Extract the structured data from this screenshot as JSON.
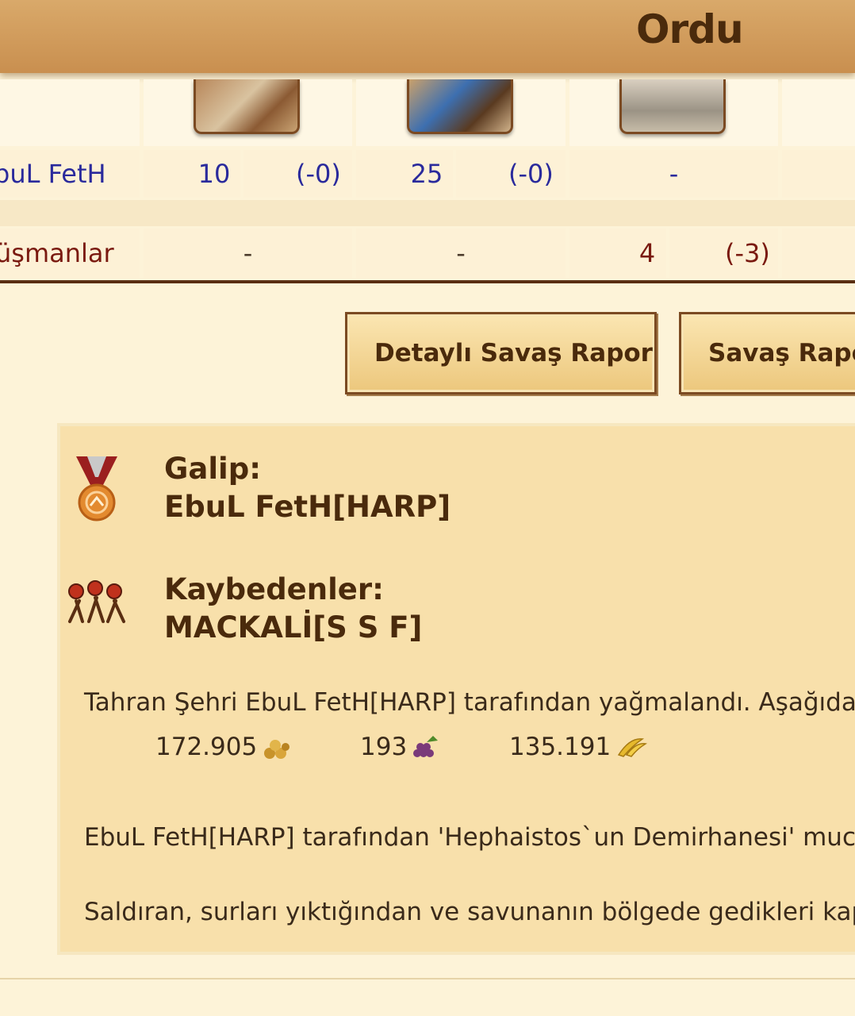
{
  "header": {
    "title": "Ordu"
  },
  "table": {
    "rows": [
      {
        "name": "buL FetH",
        "unit1": {
          "count": "10",
          "loss": "(-0)"
        },
        "unit2": {
          "count": "25",
          "loss": "(-0)"
        },
        "unit3": {
          "count": "-"
        }
      },
      {
        "name": "üşmanlar",
        "unit1": {
          "count": "-"
        },
        "unit2": {
          "count": "-"
        },
        "unit3": {
          "count": "4",
          "loss": "(-3)"
        }
      }
    ]
  },
  "buttons": {
    "detailed_report": "Detaylı Savaş Raporu",
    "war_report": "Savaş Raporu"
  },
  "result": {
    "winner_label": "Galip:",
    "winner_name": "EbuL FetH[HARP]",
    "losers_label": "Kaybedenler:",
    "losers_name": "MACKALİ[S S F]",
    "plunder_text": "Tahran Şehri EbuL FetH[HARP] tarafından yağmalandı. Aşağıdaki",
    "resources": {
      "gold": "172.905",
      "wine": "193",
      "bananas": "135.191"
    },
    "wonder_text": "EbuL FetH[HARP] tarafından 'Hephaistos`un Demirhanesi' mucize",
    "walls_text": "Saldıran, surları yıktığından ve savunanın bölgede gedikleri kapata"
  },
  "icons": {
    "winner": "medal-icon",
    "losers": "defeated-army-icon",
    "gold": "gold-pile-icon",
    "wine": "grapes-icon",
    "bananas": "banana-icon"
  },
  "colors": {
    "header": "#c98f4f",
    "page_bg": "#fdf3d8",
    "result_bg": "#f8e0ab",
    "player_link": "#2a2a9c",
    "enemy_text": "#7a1a10"
  }
}
